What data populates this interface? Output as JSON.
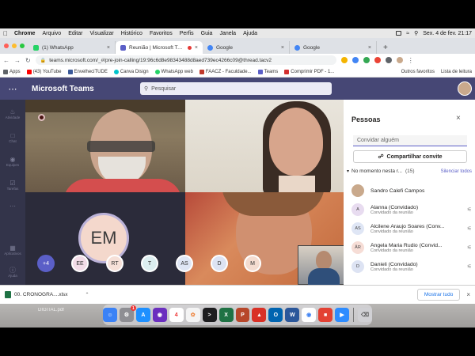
{
  "menubar": {
    "app": "Chrome",
    "items": [
      "Arquivo",
      "Editar",
      "Visualizar",
      "Histórico",
      "Favoritos",
      "Perfis",
      "Guia",
      "Janela",
      "Ajuda"
    ],
    "datetime": "Sex. 4 de fev.  21:17"
  },
  "tabs": [
    {
      "label": "(1) WhatsApp",
      "color": "#25d366",
      "active": false
    },
    {
      "label": "Reunião | Microsoft Teams",
      "color": "#5b5fc7",
      "active": true
    },
    {
      "label": "Google",
      "color": "#4285f4",
      "active": false
    },
    {
      "label": "Google",
      "color": "#4285f4",
      "active": false
    }
  ],
  "address": {
    "url": "teams.microsoft.com/_#/pre-join-calling/19:96c6d8e98343488d8aed739ec4266c09@thread.tacv2"
  },
  "bookmarks": {
    "items": [
      {
        "label": "Apps",
        "color": "#5f6368"
      },
      {
        "label": "(43) YouTube",
        "color": "#ff0000"
      },
      {
        "label": "EnvelheciTUDE",
        "color": "#3b5998"
      },
      {
        "label": "Canva Disign",
        "color": "#00c4cc"
      },
      {
        "label": "WhatsApp web",
        "color": "#25d366"
      },
      {
        "label": "FAACZ - Faculdade...",
        "color": "#c0392b"
      },
      {
        "label": "Teams",
        "color": "#5b5fc7"
      },
      {
        "label": "Comprimir PDF - 1...",
        "color": "#d32f2f"
      }
    ],
    "other": "Outros favoritos",
    "reading_list": "Lista de leitura"
  },
  "teams": {
    "title": "Microsoft Teams",
    "search_placeholder": "Pesquisar",
    "rail": [
      "Atividade",
      "Chat",
      "Equipes",
      "Tarefas",
      "Aplicativos",
      "Ajuda"
    ]
  },
  "stage": {
    "avatar_initials": "EM",
    "roster": [
      "+4",
      "EE",
      "RT",
      "T",
      "AS",
      "D",
      "M"
    ]
  },
  "people_panel": {
    "title": "Pessoas",
    "invite_placeholder": "Convidar alguém",
    "share_label": "Compartilhar convite",
    "section_label": "No momento nesta r...",
    "section_count": "(15)",
    "mute_all": "Silenciar todos",
    "participants": [
      {
        "initials": "",
        "name": "Sandro Calefi Campos",
        "sub": "",
        "color": "#c9a98c",
        "muted": false
      },
      {
        "initials": "A",
        "name": "Alanna (Convidado)",
        "sub": "Convidado da reunião",
        "color": "#e8dcf0",
        "muted": true
      },
      {
        "initials": "AS",
        "name": "Alcilene Araujo Soares (Conv...",
        "sub": "Convidado da reunião",
        "color": "#dfe6f5",
        "muted": true
      },
      {
        "initials": "ÂR",
        "name": "Ângela Maria Rudio (Convid...",
        "sub": "Convidado da reunião",
        "color": "#f6ddd6",
        "muted": true
      },
      {
        "initials": "D",
        "name": "Danieli (Convidado)",
        "sub": "Convidado da reunião",
        "color": "#dde3f3",
        "muted": true
      }
    ]
  },
  "downloads": {
    "file": "00. CRONOGRA....xlsx",
    "show_all": "Mostrar tudo"
  },
  "desktop": {
    "label": "DIGITAL.pdf",
    "dock_calendar": "4"
  }
}
